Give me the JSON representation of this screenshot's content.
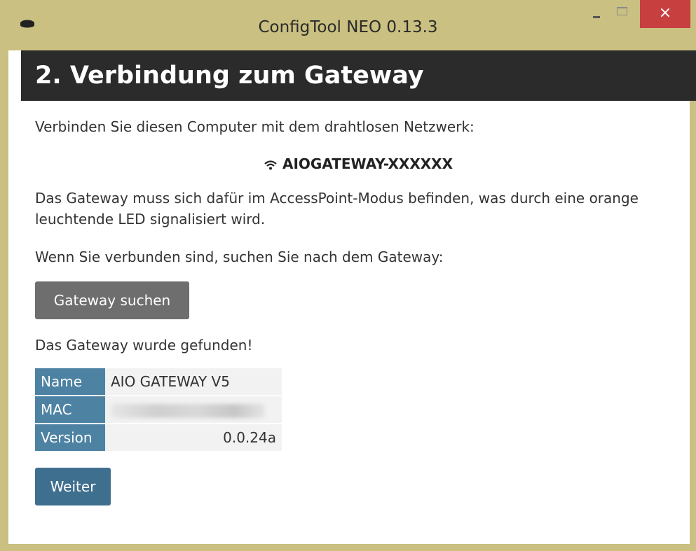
{
  "window": {
    "title": "ConfigTool NEO 0.13.3",
    "close_glyph": "×"
  },
  "header": {
    "title": "2. Verbindung zum Gateway"
  },
  "main": {
    "intro": "Verbinden Sie diesen Computer mit dem drahtlosen Netzwerk:",
    "ssid": "AIOGATEWAY-XXXXXX",
    "ap_note": "Das Gateway muss sich dafür im AccessPoint-Modus befinden, was durch eine orange leuchtende LED signalisiert wird.",
    "search_prompt": "Wenn Sie verbunden sind, suchen Sie nach dem Gateway:",
    "search_button": "Gateway suchen",
    "found_text": "Das Gateway wurde gefunden!",
    "info_table": [
      {
        "key": "Name",
        "value": "AIO GATEWAY V5"
      },
      {
        "key": "MAC",
        "value": ""
      },
      {
        "key": "Version",
        "value": "0.0.24a"
      }
    ],
    "next_button": "Weiter"
  },
  "icons": {
    "app": "app-icon",
    "wifi": "wifi-icon"
  },
  "colors": {
    "frame": "#c9c081",
    "header_bg": "#2b2b2b",
    "key_cell": "#4d82a3",
    "search_button": "#6e6e6e",
    "next_button": "#3f6f8f",
    "close_button": "#c7403f"
  }
}
